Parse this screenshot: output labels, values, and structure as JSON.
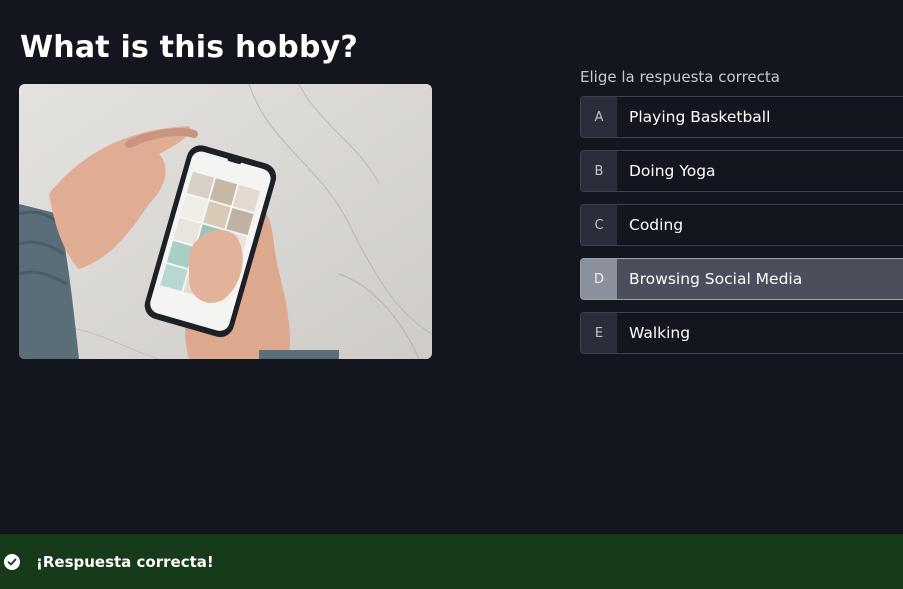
{
  "question": {
    "title": "What is this hobby?",
    "image_icon": "phone-in-hands-photo"
  },
  "answers": {
    "instructions": "Elige la respuesta correcta",
    "options": [
      {
        "key": "A",
        "label": "Playing Basketball"
      },
      {
        "key": "B",
        "label": "Doing Yoga"
      },
      {
        "key": "C",
        "label": "Coding"
      },
      {
        "key": "D",
        "label": "Browsing Social Media"
      },
      {
        "key": "E",
        "label": "Walking"
      }
    ],
    "selected_key": "D"
  },
  "feedback": {
    "icon": "check-circle-icon",
    "text": "¡Respuesta correcta!",
    "color": "#173a1b"
  },
  "colors": {
    "background": "#14161f",
    "option_selected": "#4a4f5b"
  }
}
